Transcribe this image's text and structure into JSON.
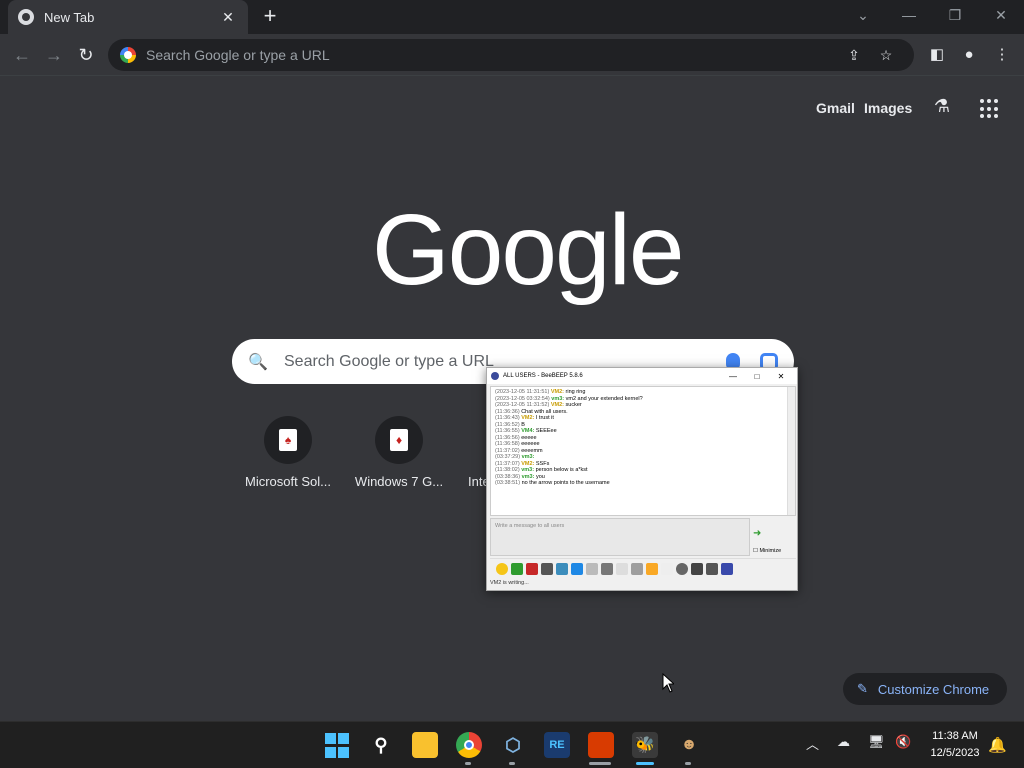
{
  "browser": {
    "tab_title": "New Tab",
    "tab_close": "✕",
    "new_tab": "+",
    "omnibox_placeholder": "Search Google or type a URL"
  },
  "ntp": {
    "gmail": "Gmail",
    "images": "Images",
    "logo": "Google",
    "search_placeholder": "Search Google or type a URL",
    "shortcuts": [
      {
        "label": "Microsoft Sol...",
        "icon": "cards-icon"
      },
      {
        "label": "Windows 7 G...",
        "icon": "cards-icon"
      },
      {
        "label": "Inte",
        "icon": "cards-icon"
      }
    ],
    "customize": "Customize Chrome"
  },
  "beebeep": {
    "title": "ALL USERS - BeeBEEP 5.8.6",
    "lines": [
      {
        "ts": "(2023-12-05 11:31:51)",
        "name": "VM2",
        "text": "ring ring"
      },
      {
        "ts": "(2023-12-05 03:32:54)",
        "name": "vm3",
        "text": "vm2 and your extended kernel?"
      },
      {
        "ts": "(2023-12-05 11:31:52)",
        "name": "VM2",
        "text": "sucker"
      },
      {
        "ts": "(11:36:36)",
        "name": "",
        "text": "Chat with all users."
      },
      {
        "ts": "(11:36:43)",
        "name": "VM2",
        "text": "I trust it"
      },
      {
        "ts": "(11:36:52)",
        "name": "",
        "text": "B"
      },
      {
        "ts": "(11:36:55)",
        "name": "VM4",
        "text": "SEEEee"
      },
      {
        "ts": "(11:36:56)",
        "name": "",
        "text": "eeeee"
      },
      {
        "ts": "(11:36:58)",
        "name": "",
        "text": "eeeeee"
      },
      {
        "ts": "(11:37:02)",
        "name": "",
        "text": "eeeemm"
      },
      {
        "ts": "(03:37:29)",
        "name": "vm3",
        "text": ""
      },
      {
        "ts": "(11:37:07)",
        "name": "VM2",
        "text": "SSFs"
      },
      {
        "ts": "(11:38:02)",
        "name": "vm3",
        "text": "person below is a*kst"
      },
      {
        "ts": "(03:38:36)",
        "name": "vm3",
        "text": "you"
      },
      {
        "ts": "(03:38:51)",
        "name": "",
        "text": "no the arrow points to the username"
      }
    ],
    "input_placeholder": "Write a message to all users",
    "minimize": "Minimize",
    "status": "VM2 is writing..."
  },
  "taskbar": {
    "time": "11:38 AM",
    "date": "12/5/2023",
    "apps": [
      "start-icon",
      "search-icon",
      "file-explorer-icon",
      "chrome-icon",
      "virtualbox-icon",
      "re-app-icon",
      "office-icon",
      "beebeep-icon",
      "game-icon"
    ]
  },
  "colors": {
    "background": "#35363a",
    "tabstrip": "#202124",
    "accent_blue": "#8ab4f8"
  }
}
